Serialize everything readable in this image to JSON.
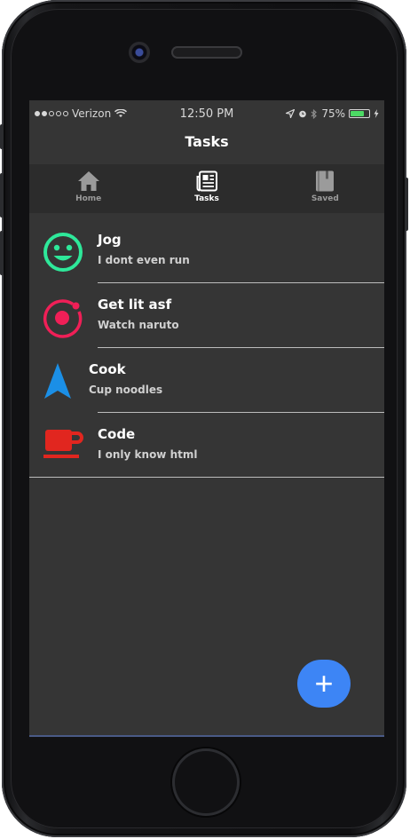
{
  "statusbar": {
    "carrier": "Verizon",
    "time": "12:50 PM",
    "battery": "75%",
    "battery_level": 0.75
  },
  "navbar": {
    "title": "Tasks"
  },
  "tabs": [
    {
      "label": "Home",
      "icon": "home-icon"
    },
    {
      "label": "Tasks",
      "icon": "newspaper-icon"
    },
    {
      "label": "Saved",
      "icon": "book-icon"
    }
  ],
  "items": [
    {
      "title": "Jog",
      "subtitle": "I dont even run",
      "icon": "smiley-icon",
      "color": "#2ee89a"
    },
    {
      "title": "Get lit asf",
      "subtitle": "Watch naruto",
      "icon": "ionic-icon",
      "color": "#f01f57"
    },
    {
      "title": "Cook",
      "subtitle": "Cup noodles",
      "icon": "navigate-icon",
      "color": "#1b8fe6"
    },
    {
      "title": "Code",
      "subtitle": "I only know html",
      "icon": "cafe-icon",
      "color": "#e1261f"
    }
  ],
  "fab": {
    "label": "+",
    "icon": "add-icon",
    "color": "#3d85f5"
  }
}
